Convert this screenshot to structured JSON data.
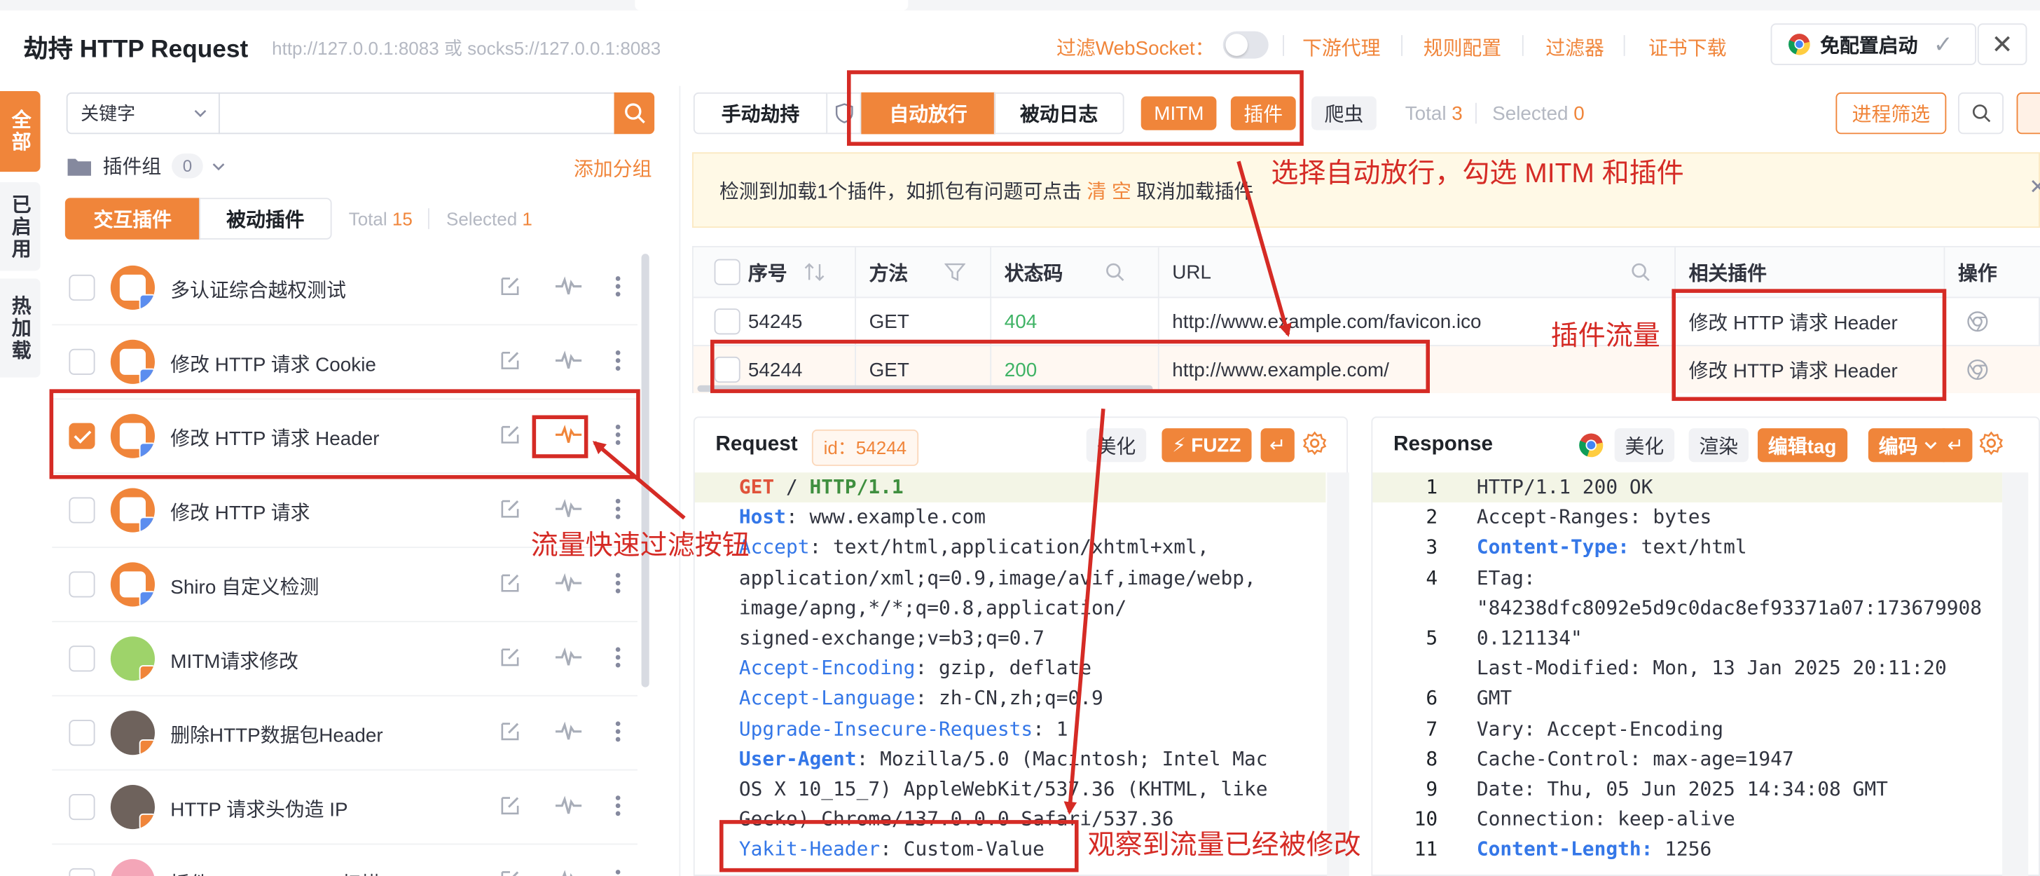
{
  "header": {
    "title": "劫持 HTTP Request",
    "proxy_address": "http://127.0.0.1:8083 或 socks5://127.0.0.1:8083",
    "filter_websocket_label": "过滤WebSocket：",
    "links": [
      "下游代理",
      "规则配置",
      "过滤器",
      "证书下载"
    ],
    "start_button": "免配置启动",
    "close": "✕"
  },
  "left_tabs": [
    "全部",
    "已启用",
    "热加载"
  ],
  "plugin_panel": {
    "search_type": "关键字",
    "group_label": "插件组",
    "group_count": "0",
    "add_group": "添加分组",
    "tabs": [
      "交互插件",
      "被动插件"
    ],
    "total_label": "Total",
    "total": "15",
    "selected_label": "Selected",
    "selected": "1",
    "plugins": [
      {
        "name": "多认证综合越权测试",
        "checked": false,
        "avatar": "orange",
        "tag": "blue"
      },
      {
        "name": "修改 HTTP 请求 Cookie",
        "checked": false,
        "avatar": "orange",
        "tag": "blue"
      },
      {
        "name": "修改 HTTP 请求 Header",
        "checked": true,
        "avatar": "orange",
        "tag": "blue"
      },
      {
        "name": "修改 HTTP 请求",
        "checked": false,
        "avatar": "orange",
        "tag": "blue"
      },
      {
        "name": "Shiro 自定义检测",
        "checked": false,
        "avatar": "orange",
        "tag": "blue"
      },
      {
        "name": "MITM请求修改",
        "checked": false,
        "avatar": "green",
        "tag": "orange"
      },
      {
        "name": "删除HTTP数据包Header",
        "checked": false,
        "avatar": "dark",
        "tag": "orange"
      },
      {
        "name": "HTTP 请求头伪造 IP",
        "checked": false,
        "avatar": "dark",
        "tag": "orange"
      },
      {
        "name": "插件 Cache-Assets 扫描",
        "checked": false,
        "avatar": "pink",
        "tag": "orange"
      }
    ]
  },
  "mode_bar": {
    "manual": "手动劫持",
    "auto": "自动放行",
    "passive_log": "被动日志",
    "mitm": "MITM",
    "plugin": "插件",
    "crawler": "爬虫",
    "total_label": "Total",
    "total": "3",
    "selected_label": "Selected",
    "selected": "0",
    "process_filter": "进程筛选"
  },
  "banner": {
    "text_before": "检测到加载1个插件，如抓包有问题可点击",
    "link": "清 空",
    "text_after": "取消加载插件"
  },
  "table": {
    "columns": [
      "序号",
      "方法",
      "状态码",
      "URL",
      "相关插件",
      "操作"
    ],
    "rows": [
      {
        "id": "54245",
        "method": "GET",
        "status": "404",
        "url": "http://www.example.com/favicon.ico",
        "plugin": "修改 HTTP 请求 Header"
      },
      {
        "id": "54244",
        "method": "GET",
        "status": "200",
        "url": "http://www.example.com/",
        "plugin": "修改 HTTP 请求 Header"
      }
    ]
  },
  "request": {
    "title": "Request",
    "id_tag": "id：54244",
    "beautify": "美化",
    "fuzz": "FUZZ",
    "lines": [
      [
        {
          "t": "GET",
          "c": "kr"
        },
        {
          "t": " / ",
          "c": ""
        },
        {
          "t": "HTTP/1.1",
          "c": "kg"
        }
      ],
      [
        {
          "t": "Host",
          "c": "kb"
        },
        {
          "t": ": www.example.com",
          "c": ""
        }
      ],
      [
        {
          "t": "Accept",
          "c": "k"
        },
        {
          "t": ": text/html,application/xhtml+xml,",
          "c": ""
        }
      ],
      [
        {
          "t": "application/xml;q=0.9,image/avif,image/webp,",
          "c": ""
        }
      ],
      [
        {
          "t": "image/apng,*/*;q=0.8,application/",
          "c": ""
        }
      ],
      [
        {
          "t": "signed-exchange;v=b3;q=0.7",
          "c": ""
        }
      ],
      [
        {
          "t": "Accept-Encoding",
          "c": "k"
        },
        {
          "t": ": gzip, deflate",
          "c": ""
        }
      ],
      [
        {
          "t": "Accept-Language",
          "c": "k"
        },
        {
          "t": ": zh-CN,zh;q=0.9",
          "c": ""
        }
      ],
      [
        {
          "t": "Upgrade-Insecure-Requests",
          "c": "k"
        },
        {
          "t": ": 1",
          "c": ""
        }
      ],
      [
        {
          "t": "User-Agent",
          "c": "kb"
        },
        {
          "t": ": Mozilla/5.0 (Macintosh; Intel Mac",
          "c": ""
        }
      ],
      [
        {
          "t": "OS X 10_15_7) AppleWebKit/537.36 (KHTML, like",
          "c": ""
        }
      ],
      [
        {
          "t": "Gecko) Chrome/137.0.0.0 Safari/537.36",
          "c": ""
        }
      ],
      [
        {
          "t": "Yakit-Header",
          "c": "k"
        },
        {
          "t": ": Custom-Value",
          "c": ""
        }
      ]
    ]
  },
  "response": {
    "title": "Response",
    "beautify": "美化",
    "render": "渲染",
    "edit_tag": "编辑tag",
    "encode": "编码",
    "line_numbers": [
      "1",
      "2",
      "3",
      "4",
      "",
      "5",
      "",
      "6",
      "7",
      "8",
      "9",
      "10",
      "11"
    ],
    "lines": [
      [
        {
          "t": "HTTP/1.1 200 OK",
          "c": ""
        }
      ],
      [
        {
          "t": "Accept-Ranges: bytes",
          "c": ""
        }
      ],
      [
        {
          "t": "Content-Type:",
          "c": "kb"
        },
        {
          "t": " text/html",
          "c": ""
        }
      ],
      [
        {
          "t": "ETag: ",
          "c": ""
        }
      ],
      [
        {
          "t": "\"84238dfc8092e5d9c0dac8ef93371a07:173679908",
          "c": ""
        }
      ],
      [
        {
          "t": "0.121134\"",
          "c": ""
        }
      ],
      [
        {
          "t": "Last-Modified: Mon, 13 Jan 2025 20:11:20",
          "c": ""
        }
      ],
      [
        {
          "t": "GMT",
          "c": ""
        }
      ],
      [
        {
          "t": "Vary: Accept-Encoding",
          "c": ""
        }
      ],
      [
        {
          "t": "Cache-Control: max-age=1947",
          "c": ""
        }
      ],
      [
        {
          "t": "Date: Thu, 05 Jun 2025 14:34:08 GMT",
          "c": ""
        }
      ],
      [
        {
          "t": "Connection: keep-alive",
          "c": ""
        }
      ],
      [
        {
          "t": "Content-Length:",
          "c": "kb"
        },
        {
          "t": " 1256",
          "c": ""
        }
      ]
    ]
  },
  "annotations": {
    "auto_mitm": "选择自动放行，勾选 MITM 和插件",
    "plugin_traffic": "插件流量",
    "filter_button": "流量快速过滤按钮",
    "modified": "观察到流量已经被修改"
  },
  "colors": {
    "accent": "#f0853a",
    "annotation": "#d52b25",
    "link_blue": "#3477e8",
    "ok_green": "#3fb365"
  }
}
